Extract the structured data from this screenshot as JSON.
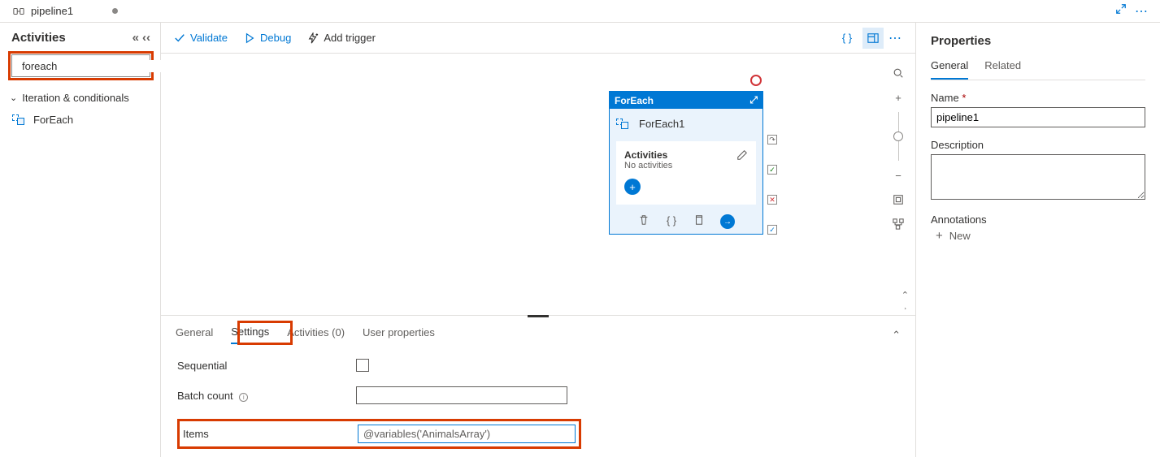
{
  "title": {
    "pipeline": "pipeline1"
  },
  "sidebar": {
    "heading": "Activities",
    "search": "foreach",
    "group": "Iteration & conditionals",
    "item": "ForEach"
  },
  "toolbar": {
    "validate": "Validate",
    "debug": "Debug",
    "addtrigger": "Add trigger"
  },
  "foreach": {
    "type": "ForEach",
    "name": "ForEach1",
    "activitiesLabel": "Activities",
    "noActivities": "No activities"
  },
  "bottomTabs": {
    "general": "General",
    "settings": "Settings",
    "activities": "Activities (0)",
    "userprops": "User properties"
  },
  "settings": {
    "sequential": "Sequential",
    "batchcount": "Batch count",
    "items": "Items",
    "itemsValue": "@variables('AnimalsArray')"
  },
  "properties": {
    "title": "Properties",
    "generalTab": "General",
    "relatedTab": "Related",
    "nameLabel": "Name",
    "nameValue": "pipeline1",
    "descLabel": "Description",
    "annotations": "Annotations",
    "new": "New"
  }
}
